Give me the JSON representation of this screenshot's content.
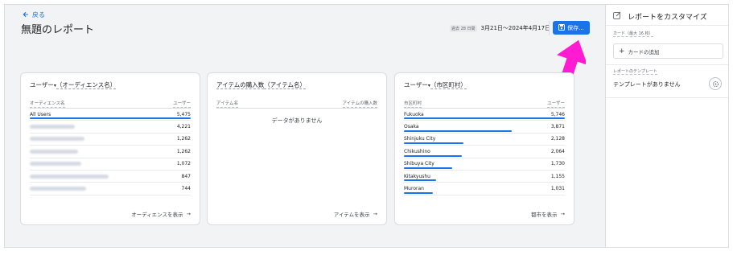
{
  "header": {
    "back_label": "戻る",
    "title": "無題のレポート",
    "date_badge": "過去 28 日間",
    "date_range": "3月21日～2024年4月17日",
    "save_label": "保存..."
  },
  "colors": {
    "accent": "#1a73e8",
    "arrow": "#ff1bd2"
  },
  "cards": {
    "audience": {
      "title_prefix": "ユーザー",
      "title_dim": "（オーディエンス名）",
      "col_left": "オーディエンス名",
      "col_right": "ユーザー",
      "rows": [
        {
          "label": "All Users",
          "value": "5,475"
        },
        {
          "label": "",
          "value": "4,221"
        },
        {
          "label": "",
          "value": "1,262"
        },
        {
          "label": "",
          "value": "1,262"
        },
        {
          "label": "",
          "value": "1,072"
        },
        {
          "label": "",
          "value": "847"
        },
        {
          "label": "",
          "value": "744"
        }
      ],
      "link": "オーディエンスを表示"
    },
    "items": {
      "title_prefix": "アイテムの購入数",
      "title_dim": "（アイテム名）",
      "col_left": "アイテム名",
      "col_right": "アイテムの購入数",
      "empty": "データがありません",
      "link": "アイテムを表示"
    },
    "cities": {
      "title_prefix": "ユーザー",
      "title_dim": "（市区町村）",
      "col_left": "市区町村",
      "col_right": "ユーザー",
      "rows": [
        {
          "label": "Fukuoka",
          "value": "5,746",
          "share": 1.0
        },
        {
          "label": "Osaka",
          "value": "3,871",
          "share": 0.67
        },
        {
          "label": "Shinjuku City",
          "value": "2,128",
          "share": 0.37
        },
        {
          "label": "Chikushino",
          "value": "2,064",
          "share": 0.36
        },
        {
          "label": "Shibuya City",
          "value": "1,730",
          "share": 0.3
        },
        {
          "label": "Kitakyushu",
          "value": "1,155",
          "share": 0.2
        },
        {
          "label": "Muroran",
          "value": "1,031",
          "share": 0.18
        }
      ],
      "link": "都市を表示"
    }
  },
  "right_panel": {
    "title": "レポートをカスタマイズ",
    "cards_label": "カード（最大 16 枚）",
    "add_card": "カードの追加",
    "template_label": "レポートのテンプレート",
    "template_empty": "テンプレートがありません"
  }
}
